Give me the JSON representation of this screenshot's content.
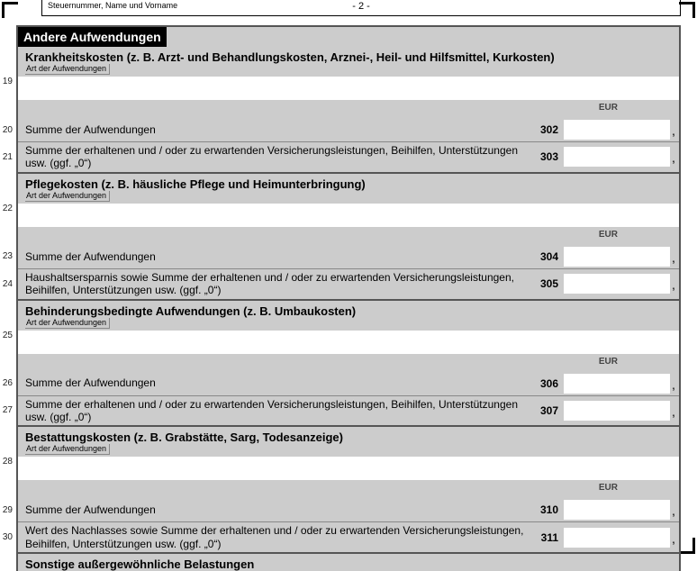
{
  "header": {
    "label": "Steuernummer, Name und Vorname",
    "page": "- 2 -"
  },
  "main_title": "Andere Aufwendungen",
  "art_label": "Art der Aufwendungen",
  "eur": "EUR",
  "sections": [
    {
      "title": "Krankheitskosten (z. B. Arzt- und Behandlungskosten, Arznei-, Heil- und Hilfsmittel, Kurkosten)",
      "white_line": "19",
      "rows": [
        {
          "line": "20",
          "text": "Summe der Aufwendungen",
          "code": "302"
        },
        {
          "line": "21",
          "text": "Summe der erhaltenen und / oder zu erwartenden Versicherungsleistungen, Beihilfen, Unterstützungen usw. (ggf. „0“)",
          "code": "303"
        }
      ]
    },
    {
      "title": "Pflegekosten (z. B. häusliche Pflege und Heimunterbringung)",
      "white_line": "22",
      "rows": [
        {
          "line": "23",
          "text": "Summe der Aufwendungen",
          "code": "304"
        },
        {
          "line": "24",
          "text": "Haushaltsersparnis sowie Summe der erhaltenen und / oder zu erwartenden Versicherungsleistungen, Beihilfen, Unterstützungen usw. (ggf. „0“)",
          "code": "305"
        }
      ]
    },
    {
      "title": "Behinderungsbedingte Aufwendungen (z. B. Umbaukosten)",
      "white_line": "25",
      "rows": [
        {
          "line": "26",
          "text": "Summe der Aufwendungen",
          "code": "306"
        },
        {
          "line": "27",
          "text": "Summe der erhaltenen und / oder zu erwartenden Versicherungsleistungen, Beihilfen, Unterstützungen usw. (ggf. „0“)",
          "code": "307"
        }
      ]
    },
    {
      "title": "Bestattungskosten (z. B. Grabstätte, Sarg, Todesanzeige)",
      "white_line": "28",
      "rows": [
        {
          "line": "29",
          "text": "Summe der Aufwendungen",
          "code": "310"
        },
        {
          "line": "30",
          "text": "Wert des Nachlasses sowie Summe der erhaltenen und / oder zu erwartenden Versicherungsleistungen, Beihilfen, Unterstützungen usw. (ggf. „0“)",
          "code": "311"
        }
      ]
    }
  ],
  "footer_title": "Sonstige außergewöhnliche Belastungen"
}
